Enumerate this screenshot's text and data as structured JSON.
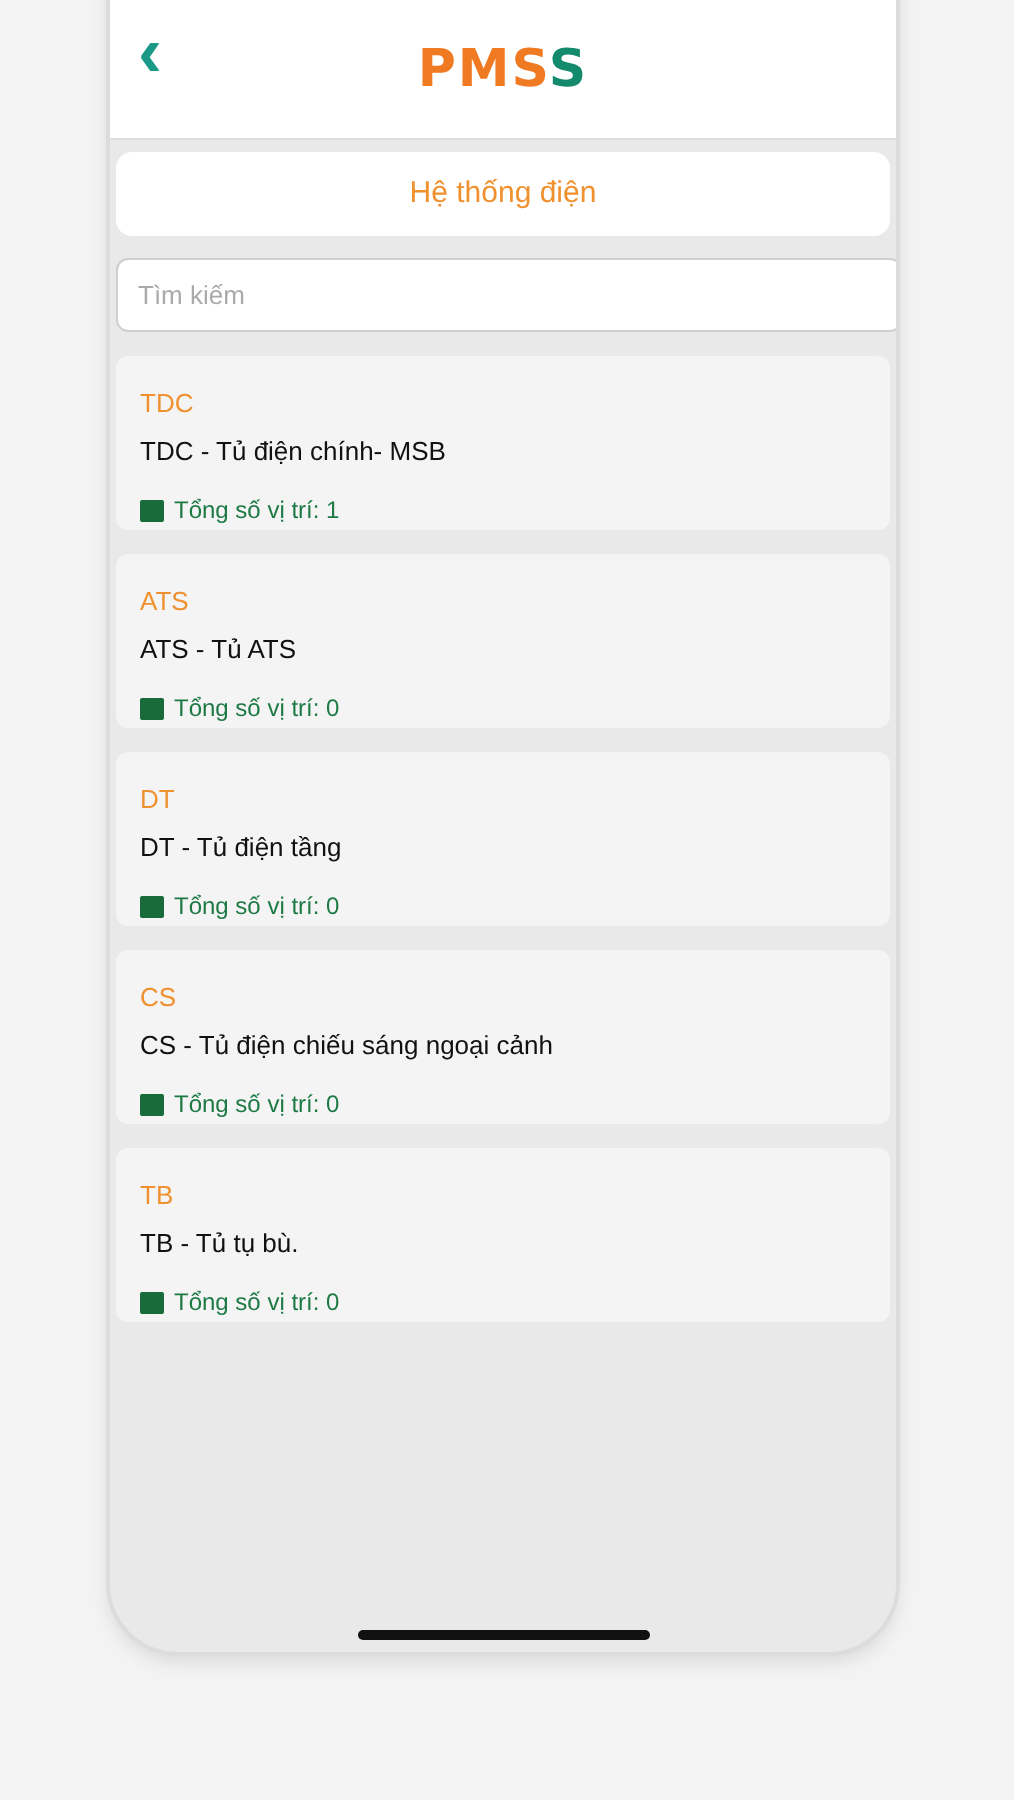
{
  "header": {
    "back": "‹",
    "logo": [
      {
        "text": "PMS",
        "color": "#f07a22"
      },
      {
        "text": "S",
        "color": "#138a6c"
      }
    ]
  },
  "title": "Hệ thống điện",
  "search": {
    "placeholder": "Tìm kiếm"
  },
  "items": [
    {
      "code": "TDC",
      "name": "TDC - Tủ điện chính- MSB",
      "count": "Tổng số vị trí: 1"
    },
    {
      "code": "ATS",
      "name": "ATS - Tủ ATS",
      "count": "Tổng số vị trí: 0"
    },
    {
      "code": "DT",
      "name": "DT - Tủ điện tầng",
      "count": "Tổng số vị trí: 0"
    },
    {
      "code": "CS",
      "name": "CS - Tủ điện chiếu sáng ngoại cảnh",
      "count": "Tổng số vị trí: 0"
    },
    {
      "code": "TB",
      "name": "TB - Tủ tụ bù.",
      "count": "Tổng số vị trí: 0"
    }
  ]
}
